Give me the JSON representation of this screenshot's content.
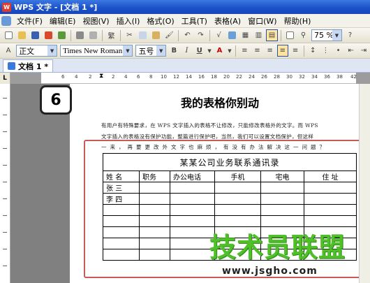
{
  "window": {
    "title": "WPS 文字 - [文档 1 *]"
  },
  "menu": {
    "items": [
      "文件(F)",
      "编辑(E)",
      "视图(V)",
      "插入(I)",
      "格式(O)",
      "工具(T)",
      "表格(A)",
      "窗口(W)",
      "帮助(H)"
    ]
  },
  "toolbar": {
    "zoom": "75 %",
    "style": "正文",
    "font": "Times New Roman",
    "size": "五号",
    "bold": "B",
    "italic": "I",
    "underline": "U",
    "font_color": "A",
    "fan_label": "繁"
  },
  "tab": {
    "label": "文档 1 *"
  },
  "ruler": {
    "corner": "L",
    "numbers": [
      "6",
      "4",
      "2",
      "2",
      "4",
      "6",
      "8",
      "10",
      "12",
      "14",
      "16",
      "18",
      "20",
      "22",
      "24",
      "26",
      "28",
      "30",
      "32",
      "34",
      "36",
      "38",
      "42"
    ]
  },
  "badge": {
    "number": "6"
  },
  "document": {
    "title": "我的表格你别动",
    "para": [
      "有用户有特殊要求，在 WPS 文字插入的表格不让修改，只能修改表格外的文字。而 WPS",
      "文字插入的表格没有保护功能，整篇进行保护吧，当然，我们可以设置文档保护，但这样",
      "一来，再要更改外文字也麻烦，有没有办法解决这一问题？"
    ]
  },
  "table": {
    "caption": "某某公司业务联系通讯录",
    "headers": [
      "姓 名",
      "职务",
      "办公电话",
      "手机",
      "宅电",
      "住  址"
    ],
    "rows": [
      [
        "张 三",
        "",
        "",
        "",
        "",
        ""
      ],
      [
        "李 四",
        "",
        "",
        "",
        "",
        ""
      ],
      [
        "",
        "",
        "",
        "",
        "",
        ""
      ],
      [
        "",
        "",
        "",
        "",
        "",
        ""
      ],
      [
        "",
        "",
        "",
        "",
        "",
        ""
      ],
      [
        "",
        "",
        "",
        "",
        "",
        ""
      ],
      [
        "",
        "",
        "",
        "",
        "",
        ""
      ]
    ]
  },
  "watermark": {
    "main": "技术员联盟",
    "url": "www.jsgho.com"
  },
  "colors": {
    "title_bar": "#1a50c8",
    "highlight_box": "#c85a5a",
    "watermark": "#4fbf2a"
  }
}
